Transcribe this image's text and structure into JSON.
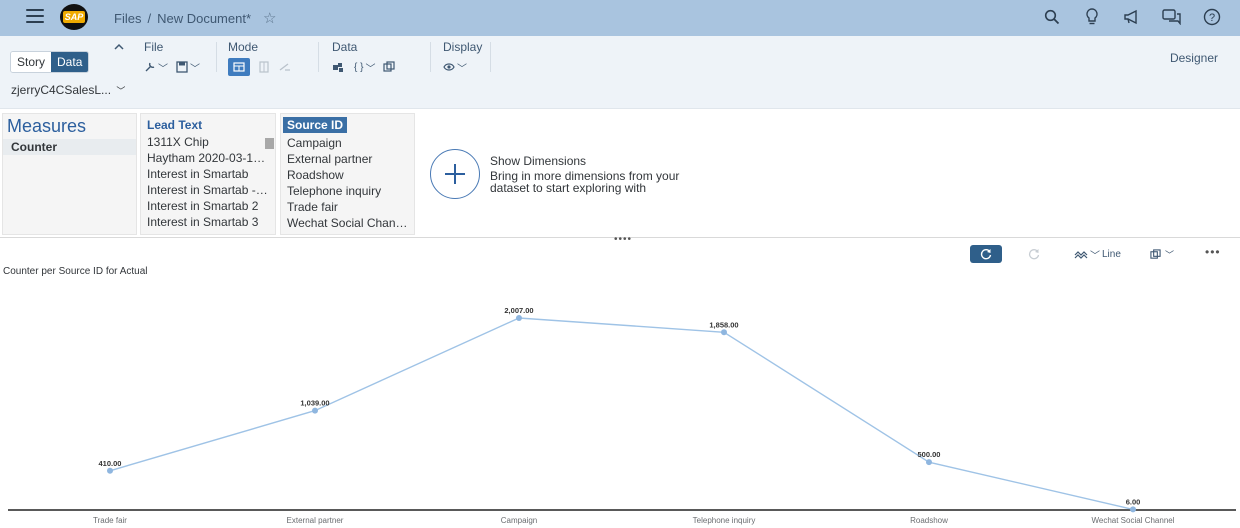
{
  "shell": {
    "breadcrumb_root": "Files",
    "separator": "/",
    "document_title": "New Document*",
    "logo_text": "SAP"
  },
  "toolbar": {
    "story_label": "Story",
    "data_label": "Data",
    "model_name": "zjerryC4CSalesL...",
    "file_label": "File",
    "mode_label": "Mode",
    "data_group_label": "Data",
    "display_label": "Display",
    "designer_label": "Designer"
  },
  "panels": {
    "measures_title": "Measures",
    "measures": [
      "Counter"
    ],
    "lead_text_header": "Lead Text",
    "lead_text_items": [
      "1311X Chip",
      "Haytham 2020-03-19...",
      "Interest in Smartab",
      "Interest in Smartab - ...",
      "Interest in Smartab 2",
      "Interest in Smartab 3"
    ],
    "source_id_header": "Source ID",
    "source_id_items": [
      "Campaign",
      "External partner",
      "Roadshow",
      "Telephone inquiry",
      "Trade fair",
      "Wechat Social Channel"
    ],
    "show_dimensions_title": "Show Dimensions",
    "show_dimensions_text": "Bring in more dimensions from your dataset to start exploring with"
  },
  "chart_tools": {
    "chart_type_label": "Line",
    "more_label": "•••"
  },
  "chart_data": {
    "type": "line",
    "title": "Counter per Source ID for Actual",
    "categories": [
      "Trade fair",
      "External partner",
      "Campaign",
      "Telephone inquiry",
      "Roadshow",
      "Wechat Social Channel"
    ],
    "series": [
      {
        "values": [
          410,
          1039,
          2007,
          1858,
          500,
          6
        ]
      }
    ],
    "data_labels": [
      "410.00",
      "1,039.00",
      "2,007.00",
      "1,858.00",
      "500.00",
      "6.00"
    ],
    "ylim": [
      0,
      2007
    ],
    "line_color": "#9fc3e6",
    "point_color": "#8fb6df",
    "grid": false
  }
}
